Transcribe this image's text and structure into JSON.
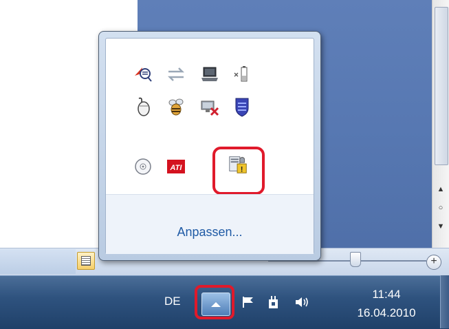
{
  "popup": {
    "customize_label": "Anpassen...",
    "icons": [
      {
        "name": "messenger-icon"
      },
      {
        "name": "network-transfer-icon"
      },
      {
        "name": "laptop-icon"
      },
      {
        "name": "battery-icon"
      },
      {
        "name": "mouse-icon"
      },
      {
        "name": "bee-icon"
      },
      {
        "name": "network-disconnected-icon"
      },
      {
        "name": "shield-icon"
      },
      {
        "name": "disc-icon"
      },
      {
        "name": "ati-icon",
        "text": "ATI"
      },
      {
        "name": "security-warning-icon"
      }
    ]
  },
  "taskbar": {
    "language": "DE",
    "time": "11:44",
    "date": "16.04.2010"
  },
  "colors": {
    "highlight": "#e01a2b",
    "taskbar": "#2f537f",
    "link": "#1f5aa5"
  }
}
